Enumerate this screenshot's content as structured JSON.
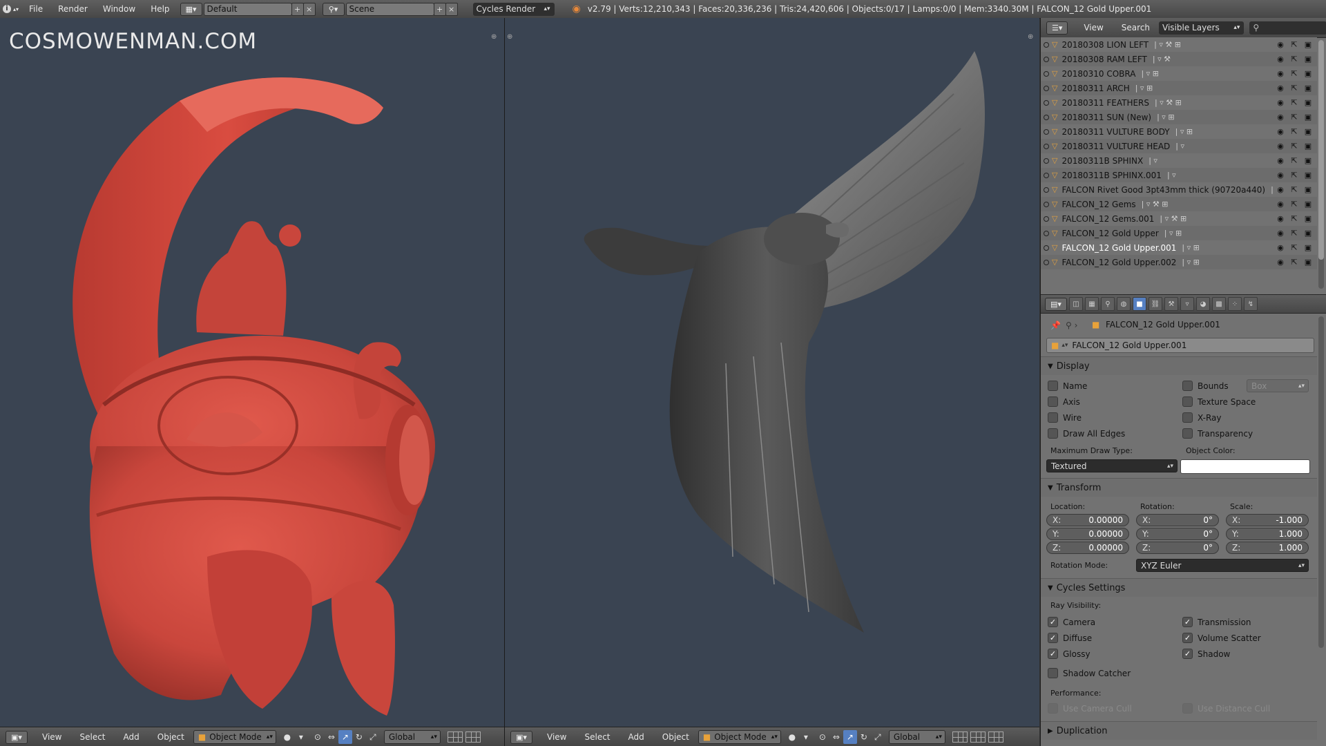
{
  "header": {
    "menus": [
      "File",
      "Render",
      "Window",
      "Help"
    ],
    "screen_layout": "Default",
    "scene": "Scene",
    "render_engine": "Cycles Render",
    "stats": "v2.79 | Verts:12,210,343 | Faces:20,336,236 | Tris:24,420,606 | Objects:0/17 | Lamps:0/0 | Mem:3340.30M | FALCON_12 Gold Upper.001"
  },
  "viewport_left": {
    "watermark": "COSMOWENMAN.COM",
    "footer": {
      "menus": [
        "View",
        "Select",
        "Add",
        "Object"
      ],
      "mode": "Object Mode",
      "orientation": "Global"
    }
  },
  "viewport_right": {
    "footer": {
      "menus": [
        "View",
        "Select",
        "Add",
        "Object"
      ],
      "mode": "Object Mode",
      "orientation": "Global"
    }
  },
  "outliner": {
    "menus": [
      "View",
      "Search"
    ],
    "display_mode": "Visible Layers",
    "rows": [
      {
        "name": "20180308 LION LEFT"
      },
      {
        "name": "20180308 RAM LEFT"
      },
      {
        "name": "20180310 COBRA"
      },
      {
        "name": "20180311 ARCH"
      },
      {
        "name": "20180311 FEATHERS"
      },
      {
        "name": "20180311 SUN (New)"
      },
      {
        "name": "20180311 VULTURE BODY"
      },
      {
        "name": "20180311 VULTURE HEAD"
      },
      {
        "name": "20180311B SPHINX"
      },
      {
        "name": "20180311B SPHINX.001"
      },
      {
        "name": "FALCON Rivet Good 3pt43mm thick (90720a440)"
      },
      {
        "name": "FALCON_12 Gems"
      },
      {
        "name": "FALCON_12 Gems.001"
      },
      {
        "name": "FALCON_12 Gold Upper"
      },
      {
        "name": "FALCON_12 Gold Upper.001"
      },
      {
        "name": "FALCON_12 Gold Upper.002"
      }
    ]
  },
  "properties": {
    "breadcrumb": "FALCON_12 Gold Upper.001",
    "object_name": "FALCON_12 Gold Upper.001",
    "display": {
      "title": "Display",
      "name": "Name",
      "axis": "Axis",
      "wire": "Wire",
      "draw_all_edges": "Draw All Edges",
      "bounds": "Bounds",
      "bounds_type": "Box",
      "texture_space": "Texture Space",
      "xray": "X-Ray",
      "transparency": "Transparency",
      "max_draw_type_label": "Maximum Draw Type:",
      "max_draw_type": "Textured",
      "object_color_label": "Object Color:"
    },
    "transform": {
      "title": "Transform",
      "location_label": "Location:",
      "rotation_label": "Rotation:",
      "scale_label": "Scale:",
      "location": {
        "x": "0.00000",
        "y": "0.00000",
        "z": "0.00000"
      },
      "rotation": {
        "x": "0°",
        "y": "0°",
        "z": "0°"
      },
      "scale": {
        "x": "-1.000",
        "y": "1.000",
        "z": "1.000"
      },
      "axis_x": "X:",
      "axis_y": "Y:",
      "axis_z": "Z:",
      "rotation_mode_label": "Rotation Mode:",
      "rotation_mode": "XYZ Euler"
    },
    "cycles": {
      "title": "Cycles Settings",
      "ray_visibility_label": "Ray Visibility:",
      "camera": "Camera",
      "diffuse": "Diffuse",
      "glossy": "Glossy",
      "transmission": "Transmission",
      "volume_scatter": "Volume Scatter",
      "shadow": "Shadow",
      "shadow_catcher": "Shadow Catcher",
      "performance_label": "Performance:",
      "use_camera_cull": "Use Camera Cull",
      "use_distance_cull": "Use Distance Cull"
    },
    "duplication": {
      "title": "Duplication"
    }
  },
  "colors": {
    "viewport_bg": "#3a4452",
    "helmet": "#c9463c",
    "falcon": "#5a5a5a",
    "accent": "#5680c2"
  }
}
